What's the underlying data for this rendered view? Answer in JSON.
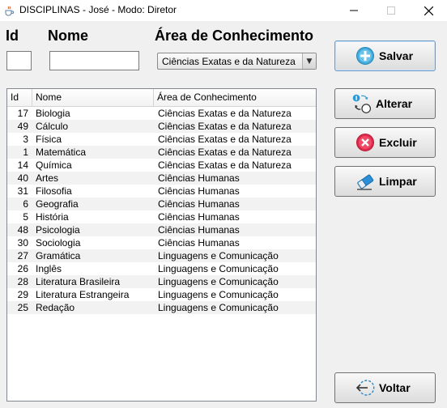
{
  "window": {
    "title": "DISCIPLINAS - José - Modo: Diretor"
  },
  "form": {
    "id_label": "Id",
    "nome_label": "Nome",
    "area_label": "Área de Conhecimento",
    "id_value": "",
    "nome_value": "",
    "area_selected": "Ciências Exatas e da Natureza"
  },
  "buttons": {
    "salvar": "Salvar",
    "alterar": "Alterar",
    "excluir": "Excluir",
    "limpar": "Limpar",
    "voltar": "Voltar"
  },
  "table": {
    "columns": [
      "Id",
      "Nome",
      "Área de Conhecimento"
    ],
    "rows": [
      [
        "17",
        "Biologia",
        "Ciências Exatas e da Natureza"
      ],
      [
        "49",
        "Cálculo",
        "Ciências Exatas e da Natureza"
      ],
      [
        "3",
        "Física",
        "Ciências Exatas e da Natureza"
      ],
      [
        "1",
        "Matemática",
        "Ciências Exatas e da Natureza"
      ],
      [
        "14",
        "Química",
        "Ciências Exatas e da Natureza"
      ],
      [
        "40",
        "Artes",
        "Ciências Humanas"
      ],
      [
        "31",
        "Filosofia",
        "Ciências Humanas"
      ],
      [
        "6",
        "Geografia",
        "Ciências Humanas"
      ],
      [
        "5",
        "História",
        "Ciências Humanas"
      ],
      [
        "48",
        "Psicologia",
        "Ciências Humanas"
      ],
      [
        "30",
        "Sociologia",
        "Ciências Humanas"
      ],
      [
        "27",
        "Gramática",
        "Linguagens e Comunicação"
      ],
      [
        "26",
        "Inglês",
        "Linguagens e Comunicação"
      ],
      [
        "28",
        "Literatura Brasileira",
        "Linguagens e Comunicação"
      ],
      [
        "29",
        "Literatura Estrangeira",
        "Linguagens e Comunicação"
      ],
      [
        "25",
        "Redação",
        "Linguagens e Comunicação"
      ]
    ]
  },
  "icons": {
    "app": "java-cup-icon",
    "salvar": "plus-circle-icon",
    "alterar": "swap-edit-icon",
    "excluir": "x-circle-icon",
    "limpar": "eraser-icon",
    "voltar": "back-arrow-icon"
  },
  "colors": {
    "plus": "#3fa9d9",
    "x": "#e0294b",
    "eraser": "#2a8fd6"
  }
}
